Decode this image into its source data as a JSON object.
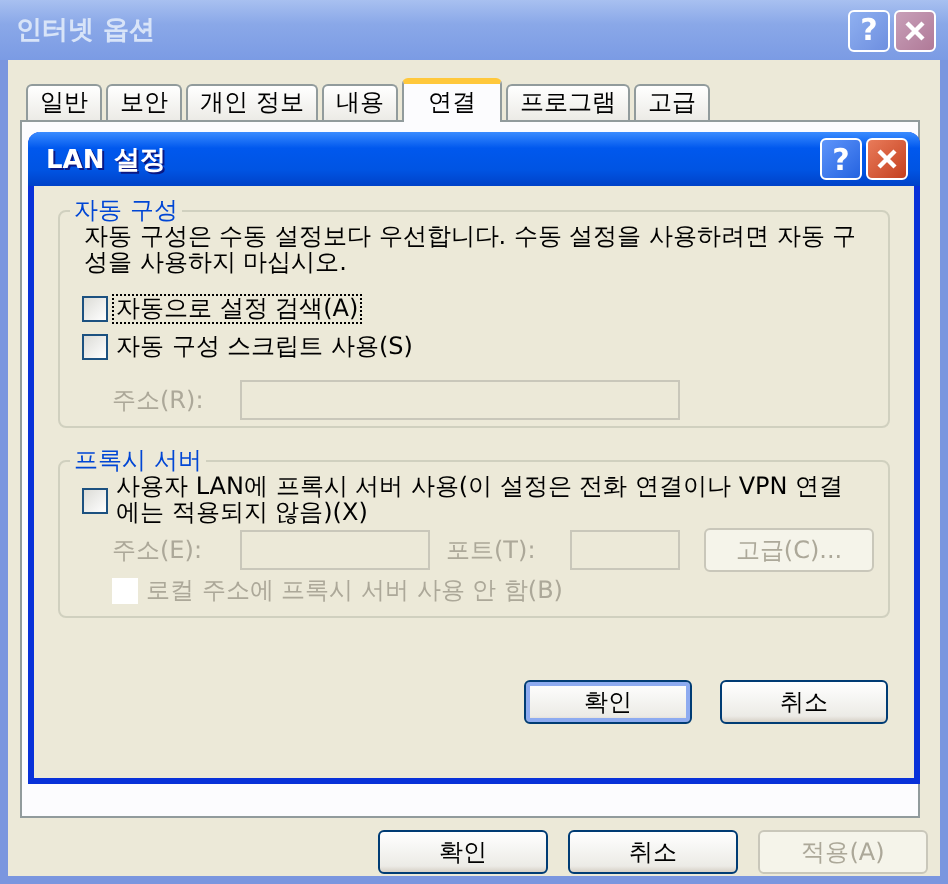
{
  "window": {
    "title": "인터넷 옵션",
    "help_button": "?"
  },
  "tabs": [
    {
      "label": "일반",
      "selected": false
    },
    {
      "label": "보안",
      "selected": false
    },
    {
      "label": "개인 정보",
      "selected": false
    },
    {
      "label": "내용",
      "selected": false
    },
    {
      "label": "연결",
      "selected": true
    },
    {
      "label": "프로그램",
      "selected": false
    },
    {
      "label": "고급",
      "selected": false
    }
  ],
  "lan_dialog": {
    "title": "LAN 설정",
    "help_button": "?",
    "auto_config": {
      "title": "자동 구성",
      "description": "자동 구성은 수동 설정보다 우선합니다. 수동 설정을 사용하려면 자동 구성을 사용하지 마십시오.",
      "options": [
        {
          "label": "자동으로 설정 검색(A)",
          "checked": false,
          "focused": true
        },
        {
          "label": "자동 구성 스크립트 사용(S)",
          "checked": false,
          "focused": false
        }
      ],
      "address": {
        "label": "주소(R):",
        "disabled": true
      }
    },
    "proxy": {
      "title": "프록시 서버",
      "use_proxy": {
        "label": "사용자 LAN에 프록시 서버 사용(이 설정은 전화 연결이나 VPN 연결에는 적용되지 않음)(X)",
        "checked": false
      },
      "address": {
        "label": "주소(E):",
        "disabled": true
      },
      "port": {
        "label": "포트(T):",
        "disabled": true
      },
      "advanced_button": {
        "label": "고급(C)...",
        "disabled": true
      },
      "bypass_local": {
        "label": "로컬 주소에 프록시 서버 사용 안 함(B)",
        "checked": false,
        "disabled": true
      }
    },
    "buttons": [
      {
        "label": "확인",
        "default": true
      },
      {
        "label": "취소",
        "default": false
      }
    ]
  },
  "footer_buttons": [
    {
      "label": "확인",
      "disabled": false
    },
    {
      "label": "취소",
      "disabled": false
    },
    {
      "label": "적용(A)",
      "disabled": true
    }
  ]
}
